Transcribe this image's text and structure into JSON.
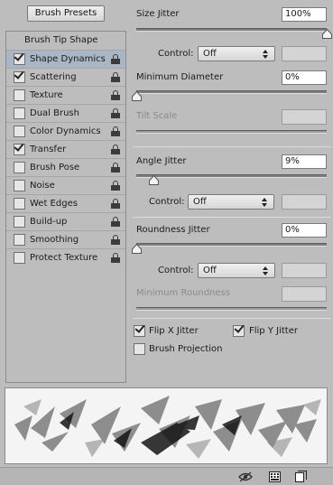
{
  "presets_button": "Brush Presets",
  "tip_header": "Brush Tip Shape",
  "items": [
    {
      "label": "Shape Dynamics",
      "checked": true,
      "selected": true
    },
    {
      "label": "Scattering",
      "checked": true,
      "selected": false
    },
    {
      "label": "Texture",
      "checked": false,
      "selected": false
    },
    {
      "label": "Dual Brush",
      "checked": false,
      "selected": false
    },
    {
      "label": "Color Dynamics",
      "checked": false,
      "selected": false
    },
    {
      "label": "Transfer",
      "checked": true,
      "selected": false
    },
    {
      "label": "Brush Pose",
      "checked": false,
      "selected": false
    },
    {
      "label": "Noise",
      "checked": false,
      "selected": false
    },
    {
      "label": "Wet Edges",
      "checked": false,
      "selected": false
    },
    {
      "label": "Build-up",
      "checked": false,
      "selected": false
    },
    {
      "label": "Smoothing",
      "checked": false,
      "selected": false
    },
    {
      "label": "Protect Texture",
      "checked": false,
      "selected": false
    }
  ],
  "size_jitter": {
    "label": "Size Jitter",
    "value": "100%",
    "level": 1.0
  },
  "control1": {
    "label": "Control:",
    "value": "Off"
  },
  "min_diameter": {
    "label": "Minimum Diameter",
    "value": "0%",
    "level": 0.0
  },
  "tilt_scale": {
    "label": "Tilt Scale"
  },
  "angle_jitter": {
    "label": "Angle Jitter",
    "value": "9%",
    "level": 0.09
  },
  "control2": {
    "label": "Control:",
    "value": "Off"
  },
  "roundness_jitter": {
    "label": "Roundness Jitter",
    "value": "0%",
    "level": 0.0
  },
  "control3": {
    "label": "Control:",
    "value": "Off"
  },
  "min_roundness": {
    "label": "Minimum Roundness"
  },
  "flip_x": {
    "label": "Flip X Jitter",
    "checked": true
  },
  "flip_y": {
    "label": "Flip Y Jitter",
    "checked": true
  },
  "brush_projection": {
    "label": "Brush Projection",
    "checked": false
  },
  "icons": {
    "eye": "eye-icon",
    "grid": "grid-icon",
    "new": "new-preset-icon"
  }
}
